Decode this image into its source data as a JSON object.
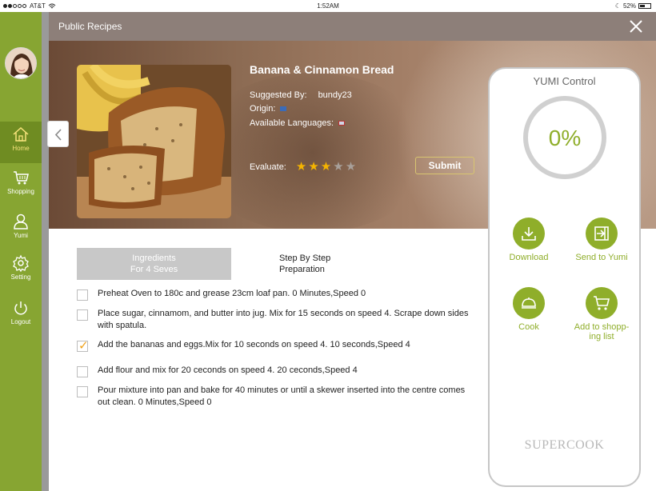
{
  "statusbar": {
    "carrier": "AT&T",
    "time": "1:52AM",
    "battery": "52%",
    "battery_level": 0.52
  },
  "sidebar": {
    "items": [
      {
        "label": "Home",
        "icon": "home-icon",
        "active": true
      },
      {
        "label": "Shopping",
        "icon": "shopping-cart-icon"
      },
      {
        "label": "Yumi",
        "icon": "user-icon"
      },
      {
        "label": "Setting",
        "icon": "gear-icon"
      },
      {
        "label": "Logout",
        "icon": "power-icon"
      }
    ]
  },
  "modal": {
    "title": "Public Recipes"
  },
  "recipe": {
    "title": "Banana & Cinnamon Bread",
    "suggested_by_label": "Suggested By:",
    "suggested_by": "bundy23",
    "origin_label": "Origin:",
    "languages_label": "Available Languages:",
    "evaluate_label": "Evaluate:",
    "rating": 3,
    "rating_max": 5,
    "submit_label": "Submit"
  },
  "tabs": {
    "ingredients_line1": "Ingredients",
    "ingredients_line2": "For 4 Seves",
    "steps_line1": "Step By Step",
    "steps_line2": "Preparation"
  },
  "steps": [
    {
      "text": "Preheat Oven to 180c and grease 23cm loaf pan.  0 Minutes,Speed 0",
      "checked": false
    },
    {
      "text": "Place sugar, cinnamom, and butter into jug. Mix for 15 seconds on speed 4. Scrape down sides with spatula.",
      "checked": false
    },
    {
      "text": "Add the bananas and eggs.Mix for 10 seconds on speed 4.  10 seconds,Speed 4",
      "checked": true
    },
    {
      "text": "Add flour and mix for 20 ceconds on speed 4.   20 ceconds,Speed 4",
      "checked": false
    },
    {
      "text": "Pour mixture into pan and bake for 40 minutes or until a skewer inserted into the centre comes out clean.  0 Minutes,Speed 0",
      "checked": false
    }
  ],
  "control": {
    "title": "YUMI Control",
    "progress": "0%",
    "download": "Download",
    "send": "Send to Yumi",
    "cook": "Cook",
    "add_line1": "Add to shopp-",
    "add_line2": "ing list",
    "brand": "SUPERCOOK"
  },
  "colors": {
    "sidebar": "#87a532",
    "accent": "#8fae2a",
    "header": "#8d7f79",
    "star": "#f5b400"
  }
}
